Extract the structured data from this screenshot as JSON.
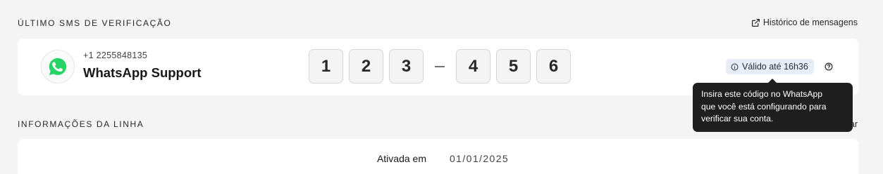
{
  "sms_section": {
    "title": "ÚLTIMO SMS DE VERIFICAÇÃO",
    "history_link": "Histórico de mensagens",
    "history_icon": "external-link-icon"
  },
  "message": {
    "phone": "+1 2255848135",
    "sender": "WhatsApp Support",
    "avatar_icon": "whatsapp-icon",
    "code_digits": [
      "1",
      "2",
      "3",
      "4",
      "5",
      "6"
    ],
    "valid_badge": "Válido até 16h36",
    "badge_icon": "info-icon",
    "help_icon": "question-circle-icon",
    "tooltip": "Insira este código no WhatsApp\nque você está configurando para\nverificar sua conta."
  },
  "line_section": {
    "title": "INFORMAÇÕES DA LINHA",
    "right_action_partial": "ar",
    "rows": [
      {
        "label": "Ativada em",
        "value": "01/01/2025"
      }
    ]
  },
  "colors": {
    "background": "#f4f4f5",
    "card": "#ffffff",
    "whatsapp_green": "#25d366",
    "badge_bg": "#e8eef8",
    "tooltip_bg": "#1f1f1f"
  }
}
